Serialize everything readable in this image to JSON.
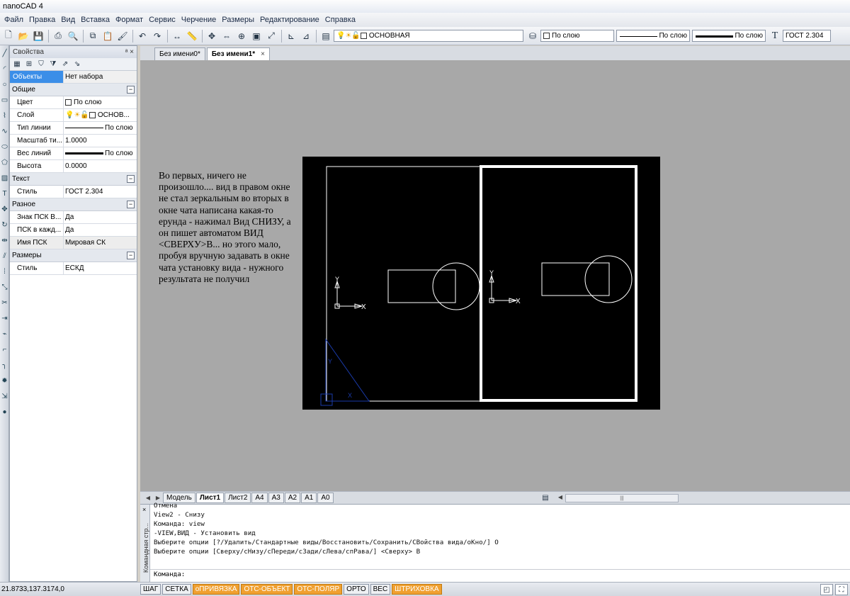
{
  "app": {
    "title": "nanoCAD 4"
  },
  "menu": [
    "Файл",
    "Правка",
    "Вид",
    "Вставка",
    "Формат",
    "Сервис",
    "Черчение",
    "Размеры",
    "Редактирование",
    "Справка"
  ],
  "toolbar": {
    "layer_value": "ОСНОВНАЯ",
    "color_value": "По слою",
    "linetype_value": "По слою",
    "lineweight_value": "По слою",
    "textstyle_value": "ГОСТ 2.304"
  },
  "properties": {
    "header": "Свойства",
    "objects_label": "Объекты",
    "objects_value": "Нет набора",
    "groups": {
      "general": "Общие",
      "text": "Текст",
      "misc": "Разное",
      "dims": "Размеры"
    },
    "general_rows": [
      {
        "name": "Цвет",
        "value": "По слою"
      },
      {
        "name": "Слой",
        "value": "ОСНОВ..."
      },
      {
        "name": "Тип линии",
        "value": "По слою"
      },
      {
        "name": "Масштаб ти...",
        "value": "1.0000"
      },
      {
        "name": "Вес линий",
        "value": "По слою"
      },
      {
        "name": "Высота",
        "value": "0.0000"
      }
    ],
    "text_rows": [
      {
        "name": "Стиль",
        "value": "ГОСТ 2.304"
      }
    ],
    "misc_rows": [
      {
        "name": "Знак ПСК В...",
        "value": "Да"
      },
      {
        "name": "ПСК в кажд...",
        "value": "Да"
      },
      {
        "name": "Имя ПСК",
        "value": "Мировая СК"
      }
    ],
    "dims_rows": [
      {
        "name": "Стиль",
        "value": "ЕСКД"
      }
    ]
  },
  "doc_tabs": [
    {
      "label": "Без имени0*",
      "active": false
    },
    {
      "label": "Без имени1*",
      "active": true
    }
  ],
  "note": "Во первых, ничего не произошло.... вид в правом окне не стал зеркальным во вторых в окне чата написана какая-то ерунда - нажимал Вид СНИЗУ, а он пишет автоматом ВИД <СВЕРХУ>В... но этого мало, пробуя вручную задавать в окне чата установку вида - нужного результата не получил",
  "ucs": {
    "y": "Y",
    "x": "X"
  },
  "layout_tabs": [
    "Модель",
    "Лист1",
    "Лист2",
    "A4",
    "A3",
    "A2",
    "A1",
    "A0"
  ],
  "layout_active": "Лист1",
  "command": {
    "side_label": "Командная стр...",
    "log": [
      "Отмена",
      "View2 - Снизу",
      "Команда: view",
      "-VIEW,ВИД - Установить вид",
      "Выберите опции [?/Удалить/Стандартные виды/Восстановить/Сохранить/СВойства вида/оКно/] О",
      "Выберите опции [Сверху/сНизу/сПереди/сЗади/сЛева/спРава/] <Сверху> В"
    ],
    "prompt": "Команда:"
  },
  "status": {
    "coords": "21.8733,137.3174,0",
    "buttons": [
      {
        "label": "ШАГ",
        "on": false
      },
      {
        "label": "СЕТКА",
        "on": false
      },
      {
        "label": "оПРИВЯЗКА",
        "on": true
      },
      {
        "label": "ОТС-ОБЪЕКТ",
        "on": true
      },
      {
        "label": "ОТС-ПОЛЯР",
        "on": true
      },
      {
        "label": "ОРТО",
        "on": false
      },
      {
        "label": "ВЕС",
        "on": false
      },
      {
        "label": "ШТРИХОВКА",
        "on": true
      }
    ]
  },
  "colors": {
    "accent_orange": "#f0a030",
    "selection_blue": "#3b8ee8",
    "canvas_gray": "#a8a8a8"
  }
}
